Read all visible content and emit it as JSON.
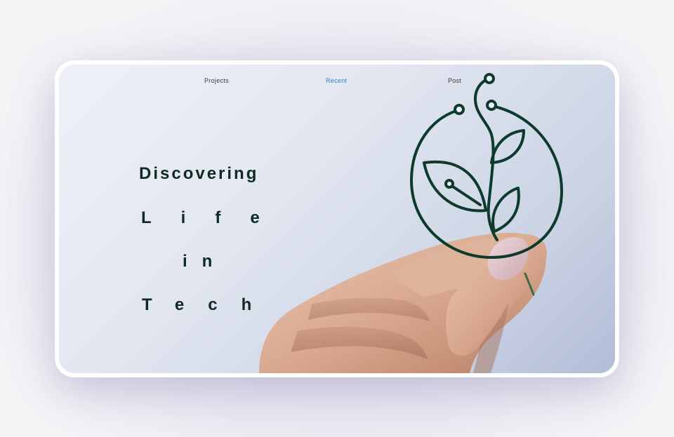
{
  "nav": {
    "items": [
      {
        "label": "Projects"
      },
      {
        "label": "Recent",
        "active": true
      },
      {
        "label": "Post"
      }
    ],
    "active_color": "#3a7bc8"
  },
  "hero": {
    "lines": [
      "Discovering",
      "Life",
      "in",
      "Tech"
    ],
    "text_color": "#0f2a22"
  },
  "logo": {
    "icon": "circuit-leaf-icon",
    "color": "#0d3a2c"
  },
  "photo": {
    "icon": "hand-holding-logo"
  }
}
